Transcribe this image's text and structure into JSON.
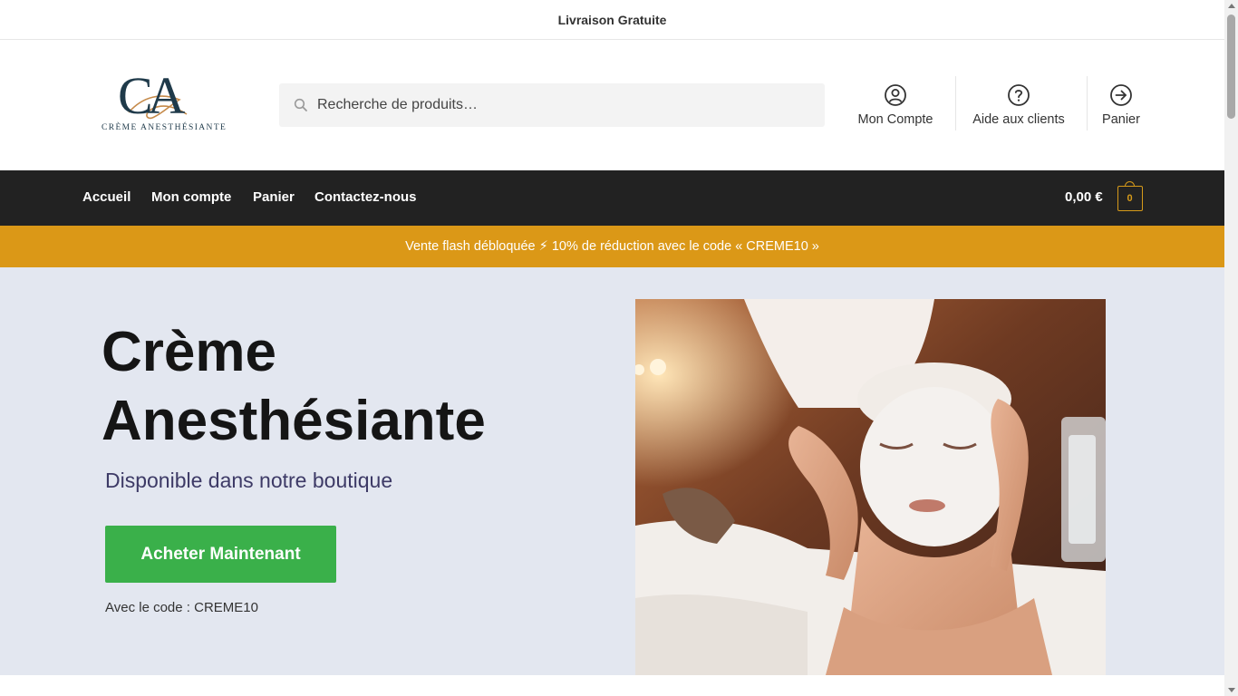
{
  "topbar": {
    "text": "Livraison Gratuite"
  },
  "logo": {
    "monogram": "CA",
    "text": "CRÈME ANESTHÉSIANTE"
  },
  "search": {
    "placeholder": "Recherche de produits…",
    "value": ""
  },
  "header_nav": [
    {
      "label": "Mon Compte",
      "icon": "user-circle-icon"
    },
    {
      "label": "Aide aux clients",
      "icon": "help-circle-icon"
    },
    {
      "label": "Panier",
      "icon": "arrow-right-circle-icon"
    }
  ],
  "main_nav": {
    "items": [
      "Accueil",
      "Mon compte",
      "Panier",
      "Contactez-nous"
    ],
    "cart_amount": "0,00 €",
    "cart_count": "0"
  },
  "promo": {
    "text": "Vente flash débloquée ⚡ 10% de réduction avec le code « CREME10 »"
  },
  "hero": {
    "title_line1": "Crème",
    "title_line2": "Anesthésiante",
    "subtitle": "Disponible dans notre boutique",
    "cta_label": "Acheter Maintenant",
    "code_note": "Avec le code : CREME10",
    "image": "facial-treatment-photo"
  },
  "colors": {
    "nav_bg": "#222222",
    "promo_bg": "#db9817",
    "hero_bg": "#e3e7f0",
    "cta_bg": "#3ab04a",
    "accent": "#d69a1a"
  }
}
